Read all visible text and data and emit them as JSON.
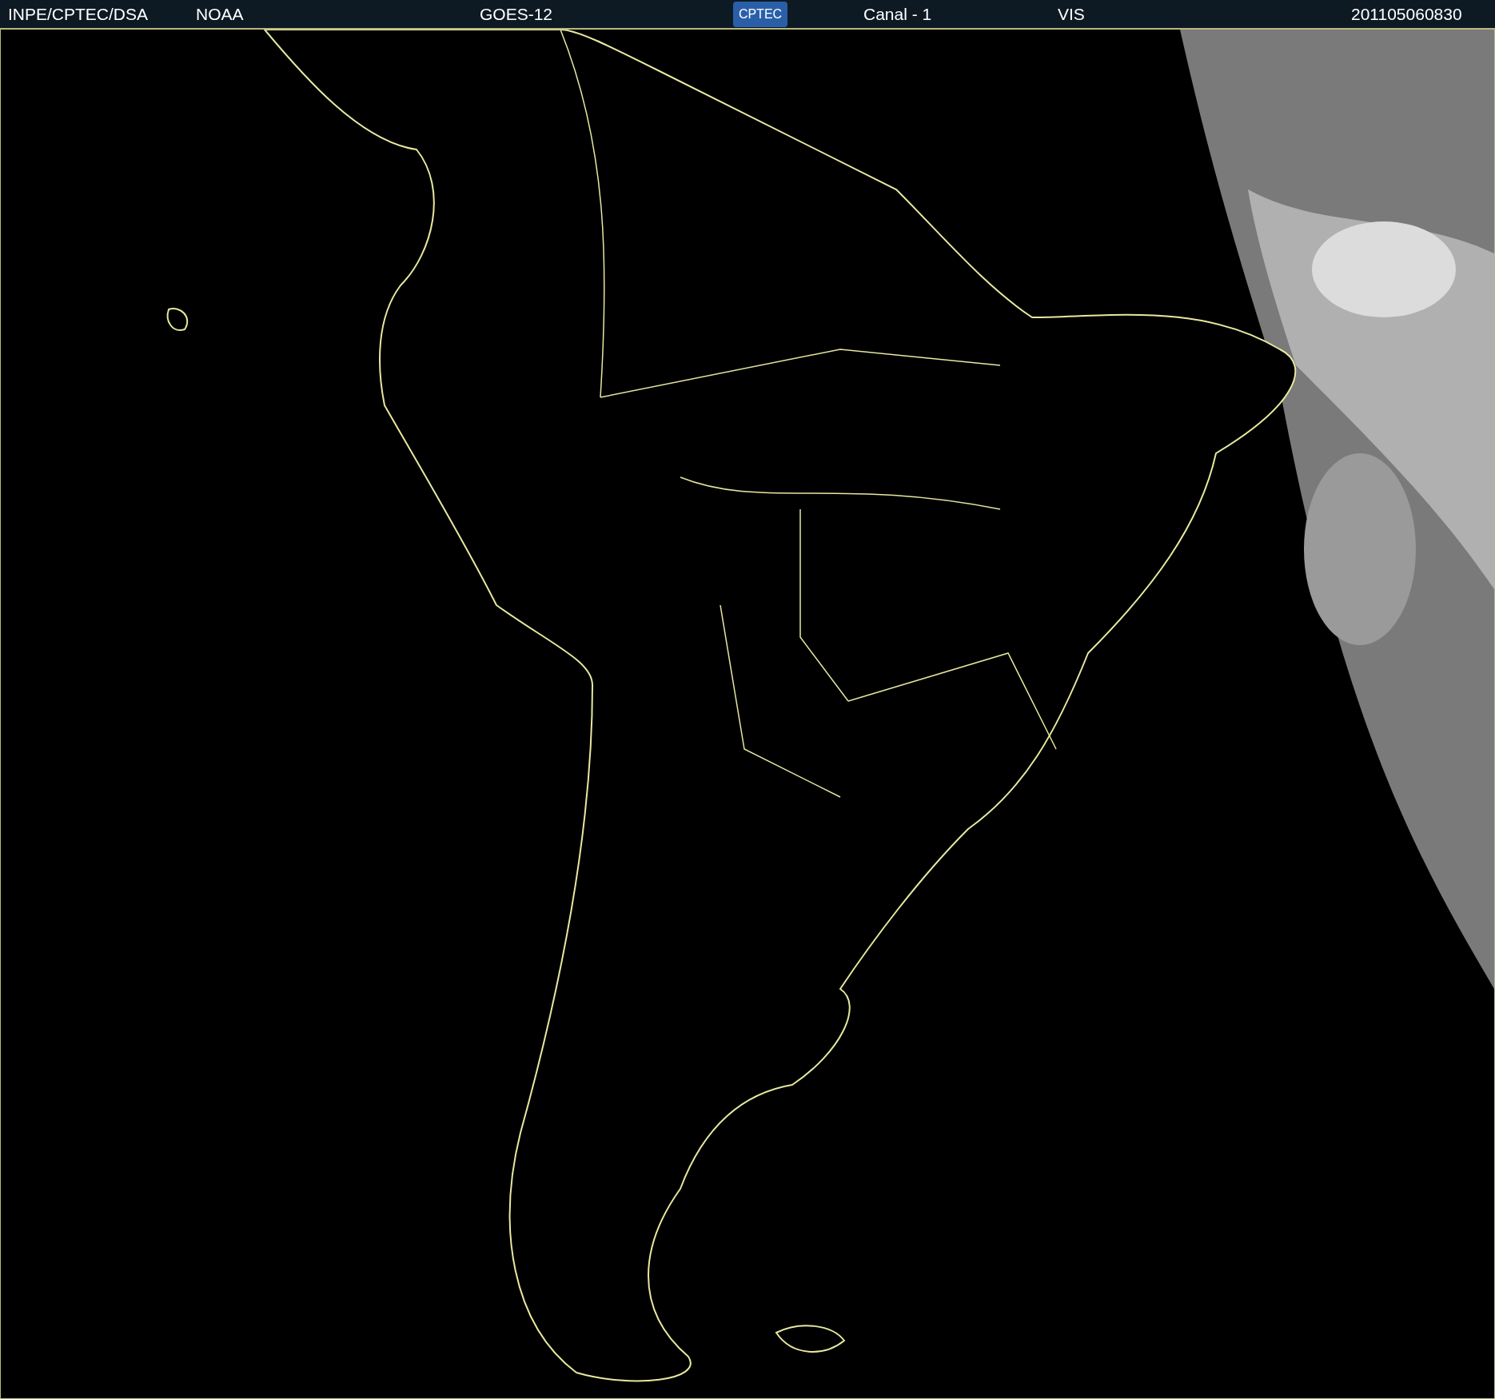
{
  "header": [
    {
      "kind": "text",
      "label": "INPE/CPTEC/DSA"
    },
    {
      "kind": "text",
      "label": "NOAA"
    },
    {
      "kind": "text",
      "label": "GOES-12"
    },
    {
      "kind": "logo",
      "label": "CPTEC"
    },
    {
      "kind": "text",
      "label": "Canal - 1"
    },
    {
      "kind": "text",
      "label": "VIS"
    },
    {
      "kind": "text",
      "label": "201105060830"
    }
  ]
}
